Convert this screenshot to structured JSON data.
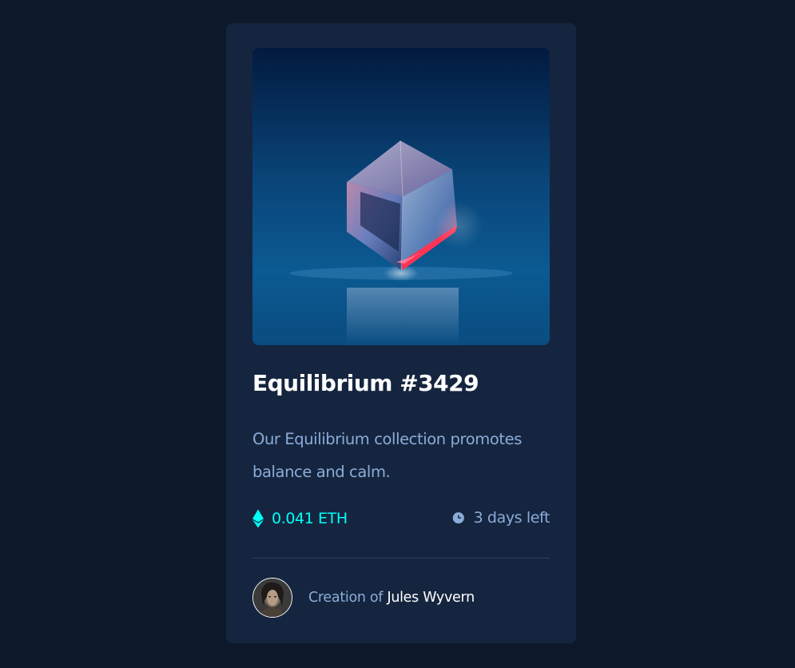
{
  "card": {
    "title": "Equilibrium #3429",
    "description": "Our Equilibrium collection promotes balance and calm.",
    "price": "0.041 ETH",
    "time_left": "3 days left",
    "creator_prefix": "Creation of",
    "creator_name": "Jules Wyvern"
  },
  "icons": {
    "price": "ethereum-icon",
    "time": "clock-icon"
  },
  "colors": {
    "background": "#0d192b",
    "card": "#15253f",
    "accent_cyan": "#00fff8",
    "soft_blue": "#8bacd9",
    "white": "#ffffff"
  }
}
